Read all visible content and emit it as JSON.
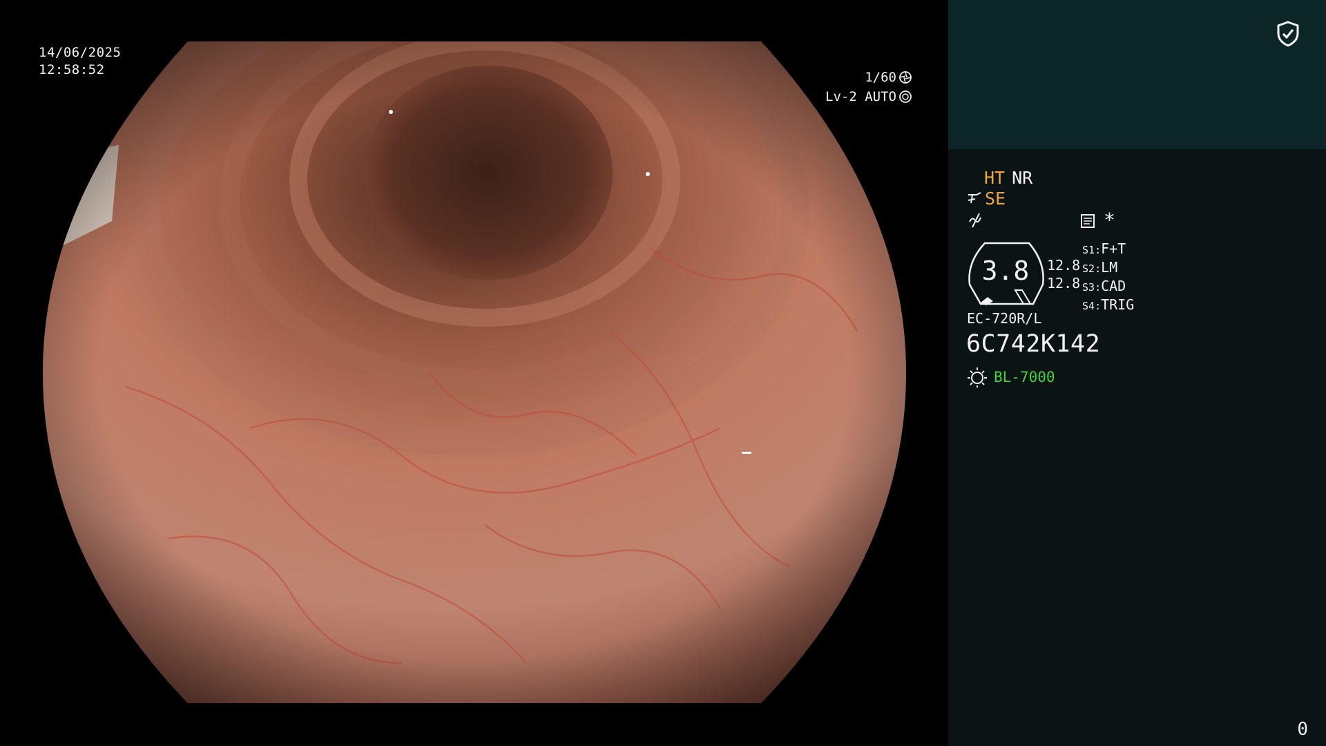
{
  "overlay": {
    "date": "14/06/2025",
    "time": "12:58:52",
    "shutter": "1/60",
    "level": "Lv-2 AUTO"
  },
  "panel": {
    "mode_ht": "HT",
    "mode_nr": "NR",
    "mode_se": "SE",
    "icon_star": "*",
    "gauge_value": "3.8",
    "gauge_num_1": "12.8",
    "gauge_num_2": "12.8",
    "settings": [
      {
        "key": "S1",
        "value": "F+T"
      },
      {
        "key": "S2",
        "value": "LM"
      },
      {
        "key": "S3",
        "value": "CAD"
      },
      {
        "key": "S4",
        "value": "TRIG"
      }
    ],
    "scope_model": "EC-720R/L",
    "scope_serial": "6C742K142",
    "light_source": "BL-7000",
    "counter": "0"
  },
  "colors": {
    "panel_top": "#0c2627",
    "panel_bottom": "#0b1314",
    "orange_text": "#f2a640",
    "green_text": "#3ed63e"
  },
  "icons": [
    "shield-check-icon",
    "aperture-icon",
    "iris-icon",
    "scope-tip-icon",
    "wave-icon",
    "document-icon",
    "sun-icon"
  ]
}
